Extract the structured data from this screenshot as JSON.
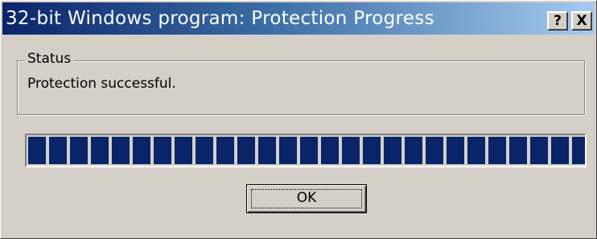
{
  "window": {
    "title": "32-bit Windows program: Protection Progress",
    "help_glyph": "?",
    "close_glyph": "X"
  },
  "status_group": {
    "legend": "Status",
    "message": "Protection successful."
  },
  "progress": {
    "fraction": 1.0,
    "block_color": "#0a246a",
    "block_count": 27
  },
  "buttons": {
    "ok_label": "OK"
  },
  "colors": {
    "titlebar_start": "#0a246a",
    "titlebar_end": "#a6caf0",
    "face": "#d4d0c8"
  }
}
